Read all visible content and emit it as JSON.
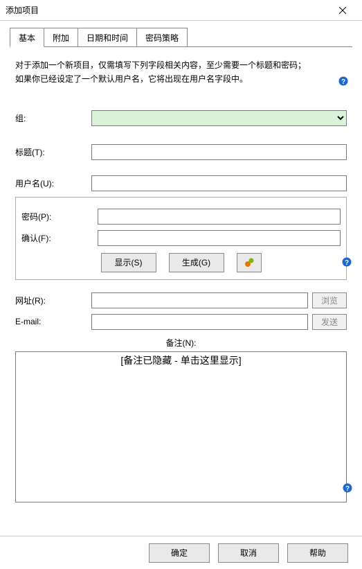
{
  "window": {
    "title": "添加项目"
  },
  "tabs": {
    "basic": "基本",
    "additional": "附加",
    "datetime": "日期和时间",
    "policy": "密码策略"
  },
  "intro": {
    "line1": "对于添加一个新项目，仅需填写下列字段相关内容，至少需要一个标题和密码；",
    "line2": "如果你已经设定了一个默认用户名，它将出现在用户名字段中。"
  },
  "labels": {
    "group": "组:",
    "title": "标题(T):",
    "username": "用户名(U):",
    "password": "密码(P):",
    "confirm": "确认(F):",
    "url": "网址(R):",
    "email": "E-mail:",
    "notes": "备注(N):"
  },
  "buttons": {
    "show": "显示(S)",
    "generate": "生成(G)",
    "browse": "浏览",
    "send": "发送",
    "ok": "确定",
    "cancel": "取消",
    "help": "帮助"
  },
  "values": {
    "group": "",
    "title": "",
    "username": "",
    "password": "",
    "confirm": "",
    "url": "",
    "email": ""
  },
  "notes": {
    "hidden_hint": "[备注已隐藏 - 单击这里显示]"
  }
}
